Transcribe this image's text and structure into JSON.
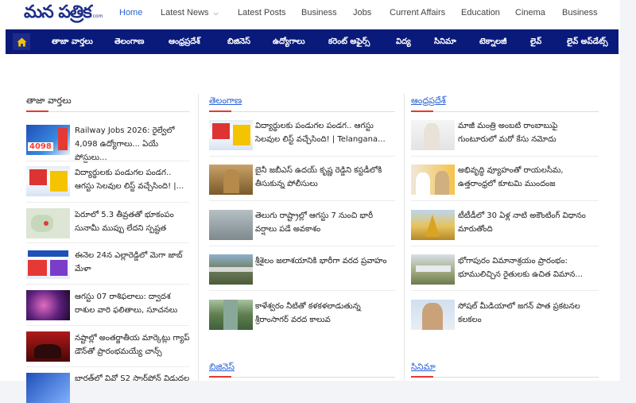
{
  "site": {
    "logo_text": "మన పత్రిక",
    "logo_suffix": ".com"
  },
  "top_nav": [
    {
      "label": "Home",
      "active": true
    },
    {
      "label": "Latest News",
      "dropdown": true
    },
    {
      "label": "Latest Posts"
    },
    {
      "label": "Business"
    },
    {
      "label": "Jobs"
    },
    {
      "label": "Current Affairs"
    },
    {
      "label": "Education"
    },
    {
      "label": "Cinema"
    },
    {
      "label": "Business"
    }
  ],
  "main_nav": [
    "తాజా వార్తలు",
    "తెలంగాణ",
    "ఆంధ్రప్రదేశ్",
    "బిజినెస్",
    "ఉద్యోగాలు",
    "కరెంట్ అఫైర్స్",
    "విద్య",
    "సినిమా",
    "టెక్నాలజీ",
    "లైవ్",
    "లైవ్ అప్‌డేట్స్"
  ],
  "colors": {
    "nav_bg": "#0a1a7a",
    "accent": "#e53935",
    "link_blue": "#2a62d8",
    "home_icon": "#f5c400"
  },
  "columns": [
    {
      "title": "తాజా వార్తలు",
      "items": [
        {
          "text": "Railway Jobs 2026: రైల్వేలో 4,098 ఉద్యోగాలు... ఏయే పోస్టులు...",
          "thumb": "railway-jobs"
        },
        {
          "text": "విద్యార్థులకు పండుగల పండగ.. ఆగస్టు సెలవుల లిస్ట్ వచ్చేసింది! |...",
          "thumb": "calendar"
        },
        {
          "text": "పెరూలో 5.3 తీవ్రతతో భూకంపం సునామీ ముప్పు లేదని స్పష్టత",
          "thumb": "map"
        },
        {
          "text": "ఈనెల 24న ఎల్లారెడ్డిలో మెగా జాబ్ మేళా",
          "thumb": "job-mela"
        },
        {
          "text": "ఆగస్టు 07 రాశిఫలాలు: ద్వాదశ రాశుల వారి ఫలితాలు, సూచనలు",
          "thumb": "zodiac"
        },
        {
          "text": "నష్టాల్లో అంతర్జాతీయ మార్కెట్లు గ్యాప్ డౌన్‌తో ప్రారంభమయ్యే చాన్స్",
          "thumb": "market"
        },
        {
          "text": "భారత్‌లో వివో S2 స్మార్ట్‌ఫోన్ విడుదల",
          "thumb": "phone"
        }
      ]
    },
    {
      "title": "తెలంగాణ",
      "items": [
        {
          "text": "విద్యార్థులకు పండుగల పండగ.. ఆగస్టు సెలవుల లిస్ట్ వచ్చేసింది! | Telangana...",
          "thumb": "calendar"
        },
        {
          "text": "బైనీ జబీఎస్ ఉదయ్ కృష్ణ రెడ్డిని కస్టడీలోకి తీసుకున్న పోలీసులు",
          "thumb": "police"
        },
        {
          "text": "తెలుగు రాష్ట్రాల్లో ఆగస్టు 7 నుంచి భారీ వర్షాలు పడే అవకాశం",
          "thumb": "rain"
        },
        {
          "text": "శ్రీశైలం జలాశయానికి భారీగా వరద ప్రవాహం",
          "thumb": "dam"
        },
        {
          "text": "కాళేశ్వరం నీటితో కళకళలాడుతున్న శ్రీరాంసాగర్ వరద కాలువ",
          "thumb": "canal"
        }
      ]
    },
    {
      "title": "ఆంధ్రప్రదేశ్",
      "items": [
        {
          "text": "మాజీ మంత్రి అంబటి రాంబాబుపై గుంటూరులో మరో కేసు నమోదు",
          "thumb": "minister"
        },
        {
          "text": "అభివృద్ధి వ్యూహంతో రాయలసీమ, ఉత్తరాంధ్రలో కూటమి ముందంజ",
          "thumb": "leaders"
        },
        {
          "text": "టీటీడీలో 30 ఏళ్ల నాటి అకౌంటింగ్ విధానం మారుతోంది",
          "thumb": "temple"
        },
        {
          "text": "భోగాపురం విమానాశ్రయం ప్రారంభం: భూములిచ్చిన రైతులకు ఉచిత విమాన...",
          "thumb": "airport"
        },
        {
          "text": "సోషల్ మీడియాలో జగన్ పాత ప్రకటనల కలకలం",
          "thumb": "jagan"
        }
      ]
    }
  ],
  "bottom_sections": [
    {
      "title": "బిజినెస్"
    },
    {
      "title": "సినిమా"
    }
  ]
}
